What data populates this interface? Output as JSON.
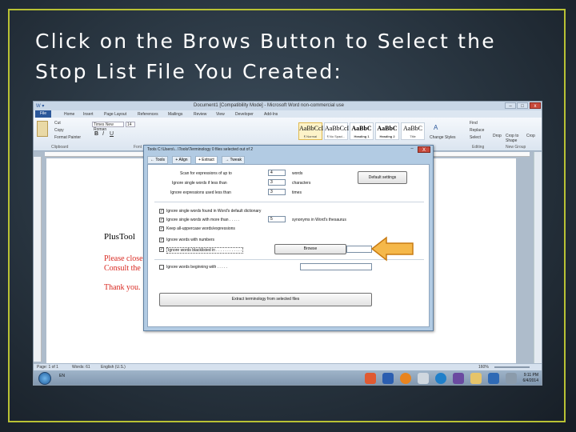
{
  "slide": {
    "title": "Click on the Brows Button to Select the\nStop List File You Created:"
  },
  "word": {
    "title_bar": "Document1 [Compatibility Mode] - Microsoft Word non-commercial use",
    "tabs": [
      "File",
      "Home",
      "Insert",
      "Page Layout",
      "References",
      "Mailings",
      "Review",
      "View",
      "Developer",
      "Add-Ins"
    ],
    "clipboard": {
      "cut": "Cut",
      "copy": "Copy",
      "format_painter": "Format Painter",
      "label": "Clipboard"
    },
    "font_name": "Times New Roman",
    "font_size": "14",
    "font_group_label": "Font",
    "styles": [
      {
        "sample": "AaBbCcI",
        "name": "¶ Normal"
      },
      {
        "sample": "AaBbCcI",
        "name": "¶ No Spaci..."
      },
      {
        "sample": "AaBbC",
        "name": "Heading 1"
      },
      {
        "sample": "AaBbC",
        "name": "Heading 2"
      },
      {
        "sample": "AaBbC",
        "name": "Title"
      }
    ],
    "change_styles": "Change Styles",
    "editing": {
      "find": "Find",
      "replace": "Replace",
      "select": "Select",
      "label": "Editing"
    },
    "new_group": {
      "drop": "Drop",
      "crop_to_shape": "Crop to Shape",
      "crop": "Crop",
      "label": "New Group"
    },
    "document": {
      "heading": "PlusTool",
      "red_lines": [
        "Please close",
        "Consult the"
      ],
      "thanks": "Thank you."
    },
    "status": {
      "page": "Page: 1 of 1",
      "words": "Words: 61",
      "language": "English (U.S.)",
      "zoom": "160%"
    },
    "taskbar": {
      "lang": "EN",
      "time": "9:11 PM",
      "date": "6/4/2014"
    }
  },
  "dialog": {
    "title": "Tools   C:\\Users\\...\\Tools\\Terminology   0 files selected out of 2",
    "tabs": [
      "Tools",
      "Align",
      "Extract",
      "Tweak"
    ],
    "close_label": "X",
    "min_label": "–",
    "scan_label": "Scan for expressions of up to",
    "scan_value": "4",
    "scan_unit": "words",
    "ignore_single_label": "Ignore single words if less than",
    "ignore_single_value": "3",
    "ignore_single_unit": "characters",
    "ignore_expr_label": "Ignore expressions used less than",
    "ignore_expr_value": "3",
    "ignore_expr_unit": "times",
    "default_settings": "Default settings",
    "options": [
      {
        "label": "Ignore single words found in Word's default dictionary",
        "checked": true
      },
      {
        "label": "Ignore single words with more than . . . . .",
        "checked": true,
        "value": "5",
        "suffix": "synonyms in Word's thesaurus"
      },
      {
        "label": "Keep all-uppercase words/expressions",
        "checked": true
      },
      {
        "label": "Ignore words with numbers",
        "checked": true
      },
      {
        "label": "Ignore words blacklisted in . . . . . . . . . . . .",
        "checked": true
      }
    ],
    "browse_label": "Browse",
    "ignore_beginning_label": "Ignore words beginning with . . . . .",
    "extract_button": "Extract terminology from selected files"
  }
}
